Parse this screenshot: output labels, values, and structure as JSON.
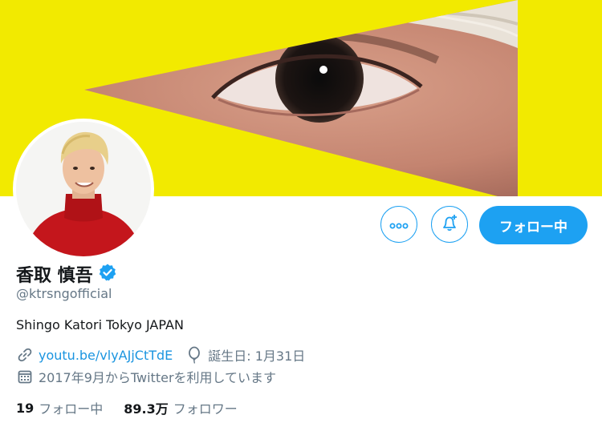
{
  "banner": {
    "accent_color": "#f2ea00"
  },
  "profile": {
    "name": "香取 慎吾",
    "verified": true,
    "handle": "@ktrsngofficial",
    "bio": "Shingo Katori Tokyo JAPAN",
    "link": "youtu.be/vlyAJjCtTdE",
    "birthday": "誕生日: 1月31日",
    "joined": "2017年9月からTwitterを利用しています"
  },
  "actions": {
    "follow_label": "フォロー中",
    "accent_color": "#1da1f2"
  },
  "stats": {
    "following_count": "19",
    "following_label": "フォロー中",
    "followers_count": "89.3万",
    "followers_label": "フォロワー"
  }
}
